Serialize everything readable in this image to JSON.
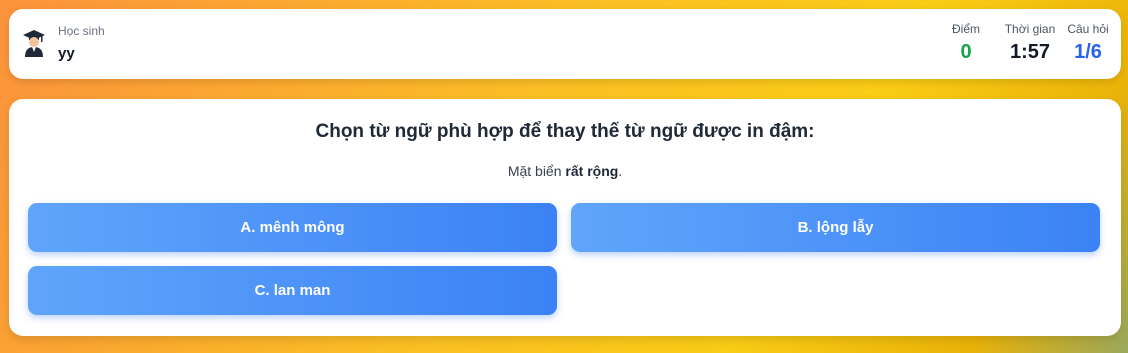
{
  "header": {
    "student_label": "Học sinh",
    "student_name": "yy",
    "avatar_icon": "student-graduate-icon",
    "stats": {
      "score_label": "Điểm",
      "score_value": "0",
      "time_label": "Thời gian",
      "time_value": "1:57",
      "question_label": "Câu hỏi",
      "question_value": "1/6"
    }
  },
  "quiz": {
    "question": "Chọn từ ngữ phù hợp để thay thế từ ngữ được in đậm:",
    "sentence_before": "Mặt biển ",
    "sentence_bold": "rất rộng",
    "sentence_after": ".",
    "options": [
      {
        "label": "A. mênh mông"
      },
      {
        "label": "B. lộng lẫy"
      },
      {
        "label": "C. lan man"
      }
    ]
  },
  "colors": {
    "score": "#16a34a",
    "question_counter": "#2563eb",
    "option_start": "#60a5fa",
    "option_end": "#3b82f6"
  }
}
